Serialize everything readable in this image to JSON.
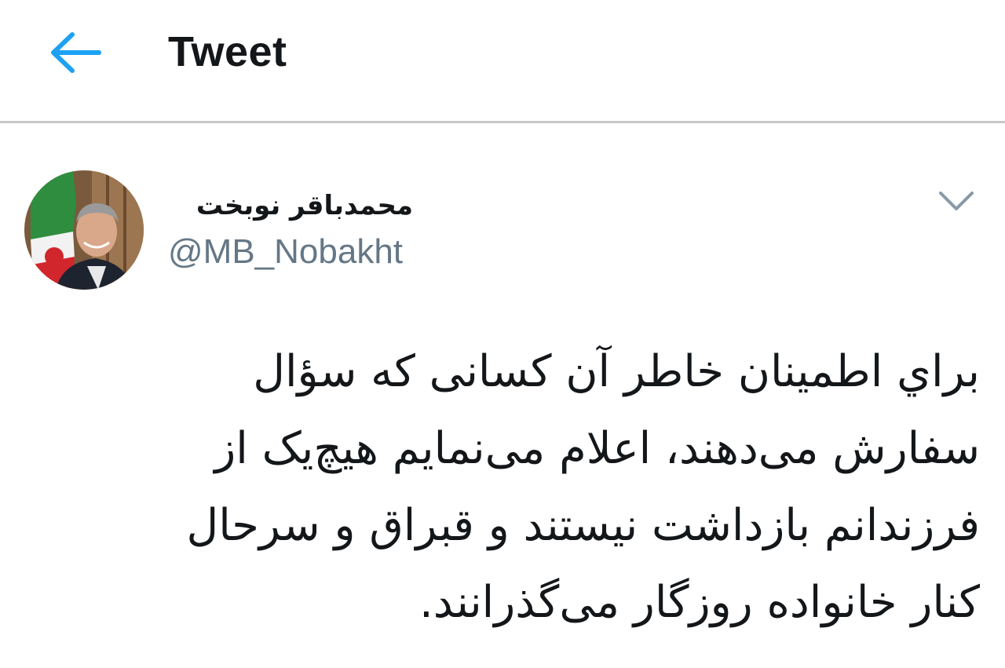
{
  "header": {
    "title": "Tweet"
  },
  "author": {
    "display_name": "محمدباقر نوبخت",
    "handle": "@MB_Nobakht"
  },
  "tweet": {
    "text": "براي اطمينان خاطر آن كسانی كه سؤال\nسفارش می‌دهند، اعلام می‌نمايم هيچ‌يک از\nفرزندانم بازداشت نيستند و قبراق و سرحال\nكنار خانواده روزگار می‌گذرانند."
  },
  "colors": {
    "accent": "#1da1f2",
    "text_primary": "#14171a",
    "text_secondary": "#657786",
    "divider": "#c8c8c8",
    "caret": "#8899a6"
  },
  "icons": {
    "back": "arrow-left-icon",
    "more": "chevron-down-icon"
  }
}
